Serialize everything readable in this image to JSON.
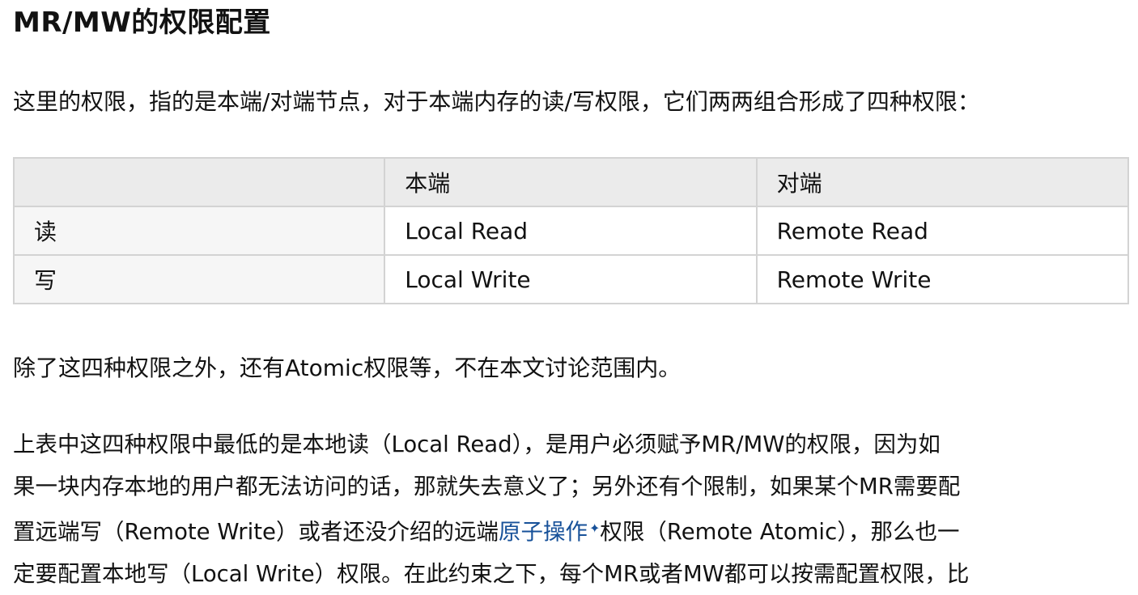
{
  "article": {
    "heading": "MR/MW的权限配置",
    "intro": "这里的权限，指的是本端/对端节点，对于本端内存的读/写权限，它们两两组合形成了四种权限：",
    "table": {
      "headers": [
        "",
        "本端",
        "对端"
      ],
      "rows": [
        [
          "读",
          "Local Read",
          "Remote Read"
        ],
        [
          "写",
          "Local Write",
          "Remote Write"
        ]
      ]
    },
    "note": "除了这四种权限之外，还有Atomic权限等，不在本文讨论范围内。",
    "body": {
      "line1": "上表中这四种权限中最低的是本地读（Local Read），是用户必须赋予MR/MW的权限，因为如",
      "line2": "果一块内存本地的用户都无法访问的话，那就失去意义了；另外还有个限制，如果某个MR需要配",
      "line3_before": "置远端写（Remote Write）或者还没介绍的远端",
      "line3_link": "原子操作",
      "line3_after": "权限（Remote Atomic），那么也一",
      "line4": "定要配置本地写（Local Write）权限。在此约束之下，每个MR或者MW都可以按需配置权限，比"
    },
    "link_icon": "sparkle-icon"
  }
}
